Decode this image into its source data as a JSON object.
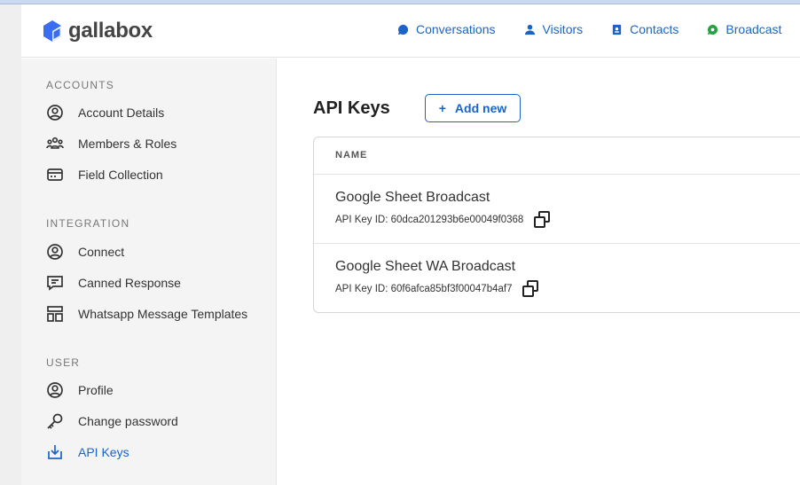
{
  "header": {
    "logo": "gallabox",
    "nav": [
      {
        "label": "Conversations",
        "icon": "chat-icon"
      },
      {
        "label": "Visitors",
        "icon": "person-icon"
      },
      {
        "label": "Contacts",
        "icon": "contact-book-icon"
      },
      {
        "label": "Broadcast",
        "icon": "whatsapp-icon"
      }
    ]
  },
  "sidebar": {
    "sections": [
      {
        "title": "ACCOUNTS",
        "items": [
          "Account Details",
          "Members & Roles",
          "Field Collection"
        ]
      },
      {
        "title": "INTEGRATION",
        "items": [
          "Connect",
          "Canned Response",
          "Whatsapp Message Templates"
        ]
      },
      {
        "title": "USER",
        "items": [
          "Profile",
          "Change password",
          "API Keys"
        ]
      }
    ],
    "active": "API Keys"
  },
  "main": {
    "title": "API Keys",
    "add_button": "Add new",
    "add_icon": "+",
    "column": "NAME",
    "rows": [
      {
        "name": "Google Sheet Broadcast",
        "id_label": "API Key ID: 60dca201293b6e00049f0368"
      },
      {
        "name": "Google Sheet WA Broadcast",
        "id_label": "API Key ID: 60f6afca85bf3f00047b4af7"
      }
    ]
  },
  "colors": {
    "accent": "#1a64c8",
    "whatsapp": "#25a244"
  }
}
